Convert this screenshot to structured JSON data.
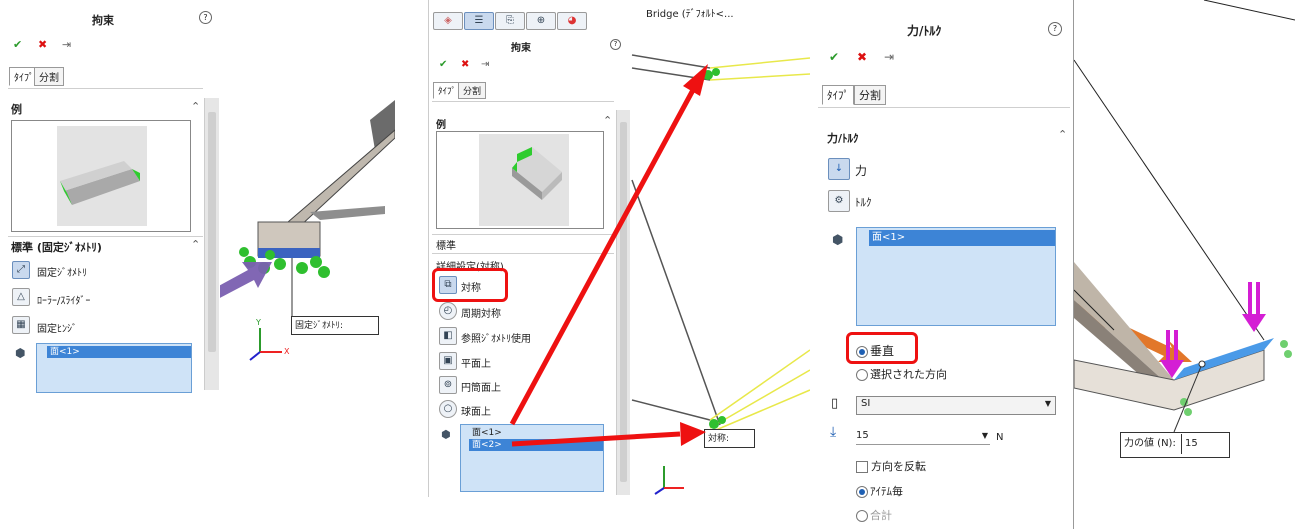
{
  "panel1": {
    "title": "拘束",
    "tabs": [
      "ﾀｲﾌﾟ",
      "分割"
    ],
    "example_header": "例",
    "standard_header": "標準 (固定ｼﾞｵﾒﾄﾘ)",
    "items": [
      "固定ｼﾞｵﾒﾄﾘ",
      "ﾛｰﾗｰ/ｽﾗｲﾀﾞｰ",
      "固定ﾋﾝｼﾞ"
    ],
    "faces": [
      "面<1>"
    ],
    "callout": "固定ｼﾞｵﾒﾄﾘ:"
  },
  "panel2": {
    "top_tabs_icons": [
      "part-icon",
      "list-icon",
      "config-icon",
      "target-icon",
      "color-icon"
    ],
    "bridge_label": "Bridge (ﾃﾞﾌｫﾙﾄ<...",
    "title": "拘束",
    "tabs": [
      "ﾀｲﾌﾟ",
      "分割"
    ],
    "example_header": "例",
    "standard_header": "標準",
    "advanced_header": "詳細設定(対称)",
    "items": [
      "対称",
      "周期対称",
      "参照ｼﾞｵﾒﾄﾘ使用",
      "平面上",
      "円筒面上",
      "球面上"
    ],
    "faces": [
      "面<1>",
      "面<2>"
    ],
    "callout": "対称:"
  },
  "panel3": {
    "title": "力/ﾄﾙｸ",
    "tabs": [
      "ﾀｲﾌﾟ",
      "分割"
    ],
    "section_header": "力/ﾄﾙｸ",
    "force_label": "力",
    "torque_label": "ﾄﾙｸ",
    "faces": [
      "面<1>"
    ],
    "direction_normal": "垂直",
    "direction_selected": "選択された方向",
    "unit_system": "SI",
    "force_value": "15",
    "force_unit": "N",
    "reverse_label": "方向を反転",
    "per_item_label": "ｱｲﾃﾑ毎",
    "total_label": "合計",
    "callout_label": "力の値 (N):",
    "callout_value": "15"
  },
  "axis": {
    "x": "X",
    "y": "Y",
    "z": "Z"
  },
  "colors": {
    "accent_red": "#ee1111",
    "arrow_purple": "#7a5fb0",
    "arrow_orange": "#e0701f",
    "selection_blue": "#3d84d6"
  }
}
